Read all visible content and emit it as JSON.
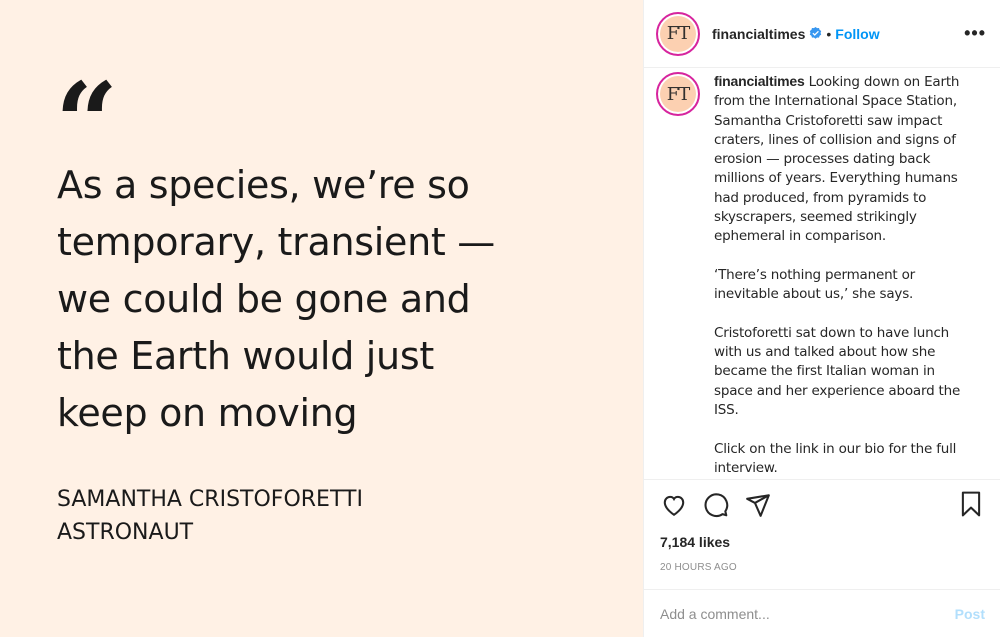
{
  "media": {
    "quote_mark": "“",
    "quote_text": "As a species, we’re so temporary, transient — we could be gone and the Earth would just keep on moving",
    "attribution_name": "SAMANTHA CRISTOFORETTI",
    "attribution_role": "ASTRONAUT"
  },
  "header": {
    "avatar_text": "FT",
    "username": "financialtimes",
    "separator": "•",
    "follow_label": "Follow",
    "more_label": "•••"
  },
  "caption": {
    "username": "financialtimes",
    "text": " Looking down on Earth from the International Space Station, Samantha Cristoforetti saw impact craters, lines of collision and signs of erosion — processes dating back millions of years. Everything humans had produced, from pyramids to skyscrapers, seemed strikingly ephemeral in comparison.\n\n‘There’s nothing permanent or inevitable about us,’ she says.\n\nCristoforetti sat down to have lunch with us and talked about how she became the first Italian woman in space and her experience aboard the ISS.\n\nClick on the link in our bio for the full interview."
  },
  "actions": {
    "likes": "7,184 likes",
    "time": "20 HOURS AGO"
  },
  "comment": {
    "placeholder": "Add a comment...",
    "post_label": "Post"
  },
  "colors": {
    "media_background": "#FFF1E5",
    "accent": "#0095f6",
    "post_disabled": "#b2dffc"
  }
}
